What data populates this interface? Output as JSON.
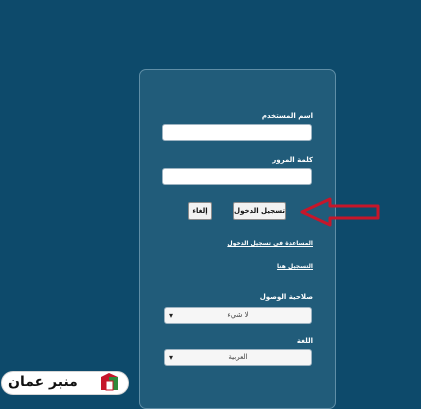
{
  "login": {
    "username_label": "اسم المستخدم",
    "username_value": "",
    "password_label": "كلمة المرور",
    "password_value": "",
    "login_button": "تسجيل الدخول",
    "cancel_button": "إلغاء",
    "help_link": "المساعدة في تسجيل الدخول",
    "register_link": "التسجيل هنا",
    "access_label": "صلاحية الوصول",
    "access_selected": "لا شيء",
    "language_label": "اللغة",
    "language_selected": "العربية"
  },
  "watermark": {
    "text": "منبر عمان"
  },
  "colors": {
    "background": "#0d4a6b",
    "panel": "#215c7a",
    "arrow": "#c6162a"
  }
}
